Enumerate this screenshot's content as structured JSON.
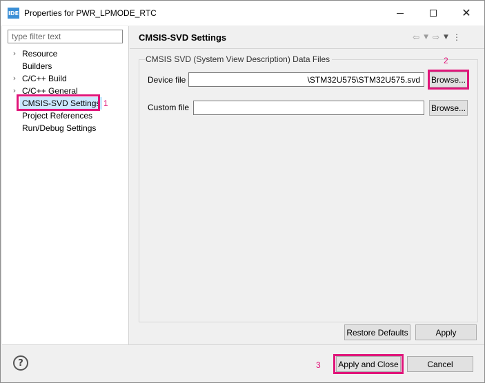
{
  "window": {
    "title": "Properties for PWR_LPMODE_RTC",
    "app_icon_text": "IDE"
  },
  "sidebar": {
    "filter_placeholder": "type filter text",
    "items": [
      {
        "label": "Resource",
        "expandable": true
      },
      {
        "label": "Builders",
        "expandable": false
      },
      {
        "label": "C/C++ Build",
        "expandable": true
      },
      {
        "label": "C/C++ General",
        "expandable": true
      },
      {
        "label": "CMSIS-SVD Settings",
        "expandable": false,
        "selected": true
      },
      {
        "label": "Project References",
        "expandable": false
      },
      {
        "label": "Run/Debug Settings",
        "expandable": false
      }
    ]
  },
  "page": {
    "title": "CMSIS-SVD Settings",
    "group_title": "CMSIS SVD (System View Description) Data Files",
    "device_file_label": "Device file",
    "device_file_value": "\\STM32U575\\STM32U575.svd",
    "custom_file_label": "Custom file",
    "custom_file_value": "",
    "browse_label": "Browse...",
    "restore_defaults_label": "Restore Defaults",
    "apply_label": "Apply"
  },
  "footer": {
    "help_symbol": "?",
    "apply_close_label": "Apply and Close",
    "cancel_label": "Cancel"
  },
  "annotations": {
    "marker_1": "1",
    "marker_2": "2",
    "marker_3": "3",
    "color": "#e0157a"
  },
  "icons": {
    "back": "back-arrow-icon",
    "forward": "forward-arrow-icon",
    "menu": "view-menu-icon",
    "chevron": "chevron-right-icon"
  }
}
